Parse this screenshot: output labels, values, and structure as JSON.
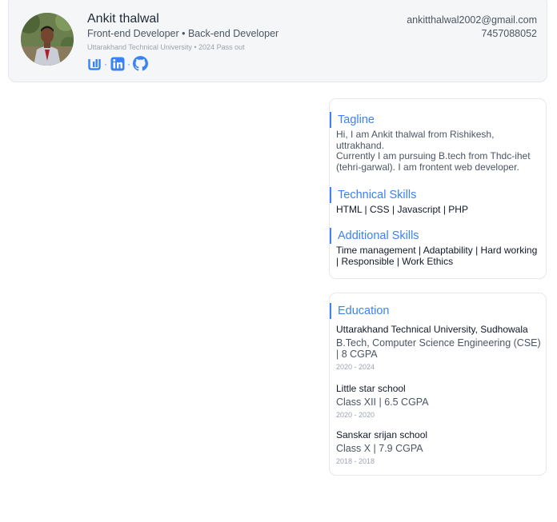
{
  "profile": {
    "name": "Ankit thalwal",
    "role": "Front-end Developer • Back-end Developer",
    "university_line": "Uttarakhand Technical University • 2024 Pass out",
    "email": "ankitthalwal2002@gmail.com",
    "phone": "7457088052",
    "social_separator": "·",
    "socials": [
      {
        "icon": "portfolio-icon"
      },
      {
        "icon": "linkedin-icon"
      },
      {
        "icon": "github-icon"
      }
    ],
    "accent_color": "#3b82f6"
  },
  "about": {
    "tagline_title": "Tagline",
    "tagline_line1": "Hi, I am Ankit thalwal from Rishikesh, uttrakhand.",
    "tagline_line2": "Currently I am pursuing B.tech from Thdc-ihet (tehri-garwal). I am frontent web developer.",
    "technical_title": "Technical Skills",
    "technical_skills": "HTML | CSS | Javascript | PHP",
    "additional_title": "Additional Skills",
    "additional_skills": "Time management | Adaptability | Hard working | Responsible | Work Ethics"
  },
  "education": {
    "title": "Education",
    "items": [
      {
        "school": "Uttarakhand Technical University, Sudhowala",
        "degree": "B.Tech, Computer Science Engineering (CSE) | 8 CGPA",
        "years": "2020 - 2024"
      },
      {
        "school": "Little star school",
        "degree": "Class XII | 6.5 CGPA",
        "years": "2020 - 2020"
      },
      {
        "school": "Sanskar srijan school",
        "degree": "Class X | 7.9 CGPA",
        "years": "2018 - 2018"
      }
    ]
  }
}
